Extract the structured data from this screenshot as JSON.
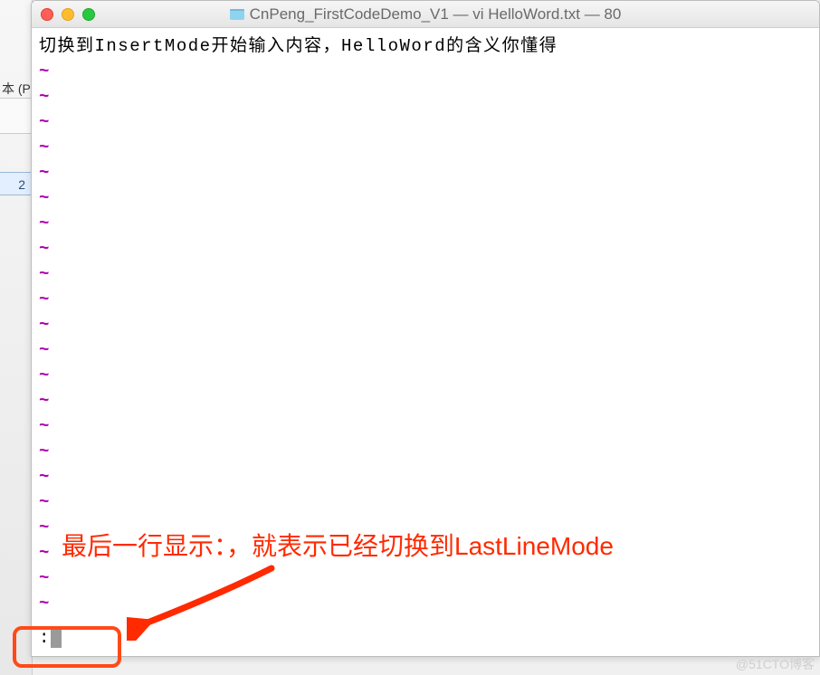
{
  "bgLeft": {
    "label": "本 (P",
    "rowNum": "2"
  },
  "window": {
    "title": "CnPeng_FirstCodeDemo_V1 — vi HelloWord.txt — 80"
  },
  "editor": {
    "content": "切换到InsertMode开始输入内容，HelloWord的含义你懂得",
    "tilde": "~",
    "tildeCount": 22,
    "cmdPrompt": ":"
  },
  "annotation": {
    "text": "最后一行显示：，就表示已经切换到LastLineMode"
  },
  "watermark": "@51CTO博客"
}
